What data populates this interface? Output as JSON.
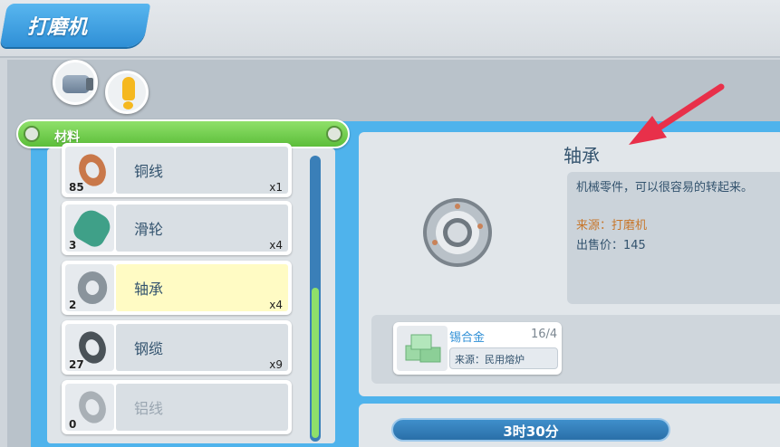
{
  "header": {
    "title": "打磨机"
  },
  "materials": {
    "label": "材料"
  },
  "items": [
    {
      "name": "铜线",
      "count": "85",
      "qty": "x1",
      "color": "#c9784a",
      "state": "normal"
    },
    {
      "name": "滑轮",
      "count": "3",
      "qty": "x4",
      "color": "#3fa088",
      "state": "normal"
    },
    {
      "name": "轴承",
      "count": "2",
      "qty": "x4",
      "color": "#8a949c",
      "state": "selected"
    },
    {
      "name": "钢缆",
      "count": "27",
      "qty": "x9",
      "color": "#4a5258",
      "state": "normal"
    },
    {
      "name": "铝线",
      "count": "0",
      "qty": "",
      "color": "#a9b0b6",
      "state": "disabled"
    }
  ],
  "detail": {
    "title": "轴承",
    "description": "机械零件，可以很容易的转起来。",
    "source": "来源：打磨机",
    "price": "出售价：145"
  },
  "requirement": {
    "name": "锡合金",
    "count": "16/4",
    "source": "来源：民用熔炉",
    "icon": "tin-alloy-icon"
  },
  "timer": {
    "label": "3时30分"
  },
  "colors": {
    "accent": "#2f8fd6",
    "green": "#5cbe3a",
    "arrow": "#e8304a"
  }
}
